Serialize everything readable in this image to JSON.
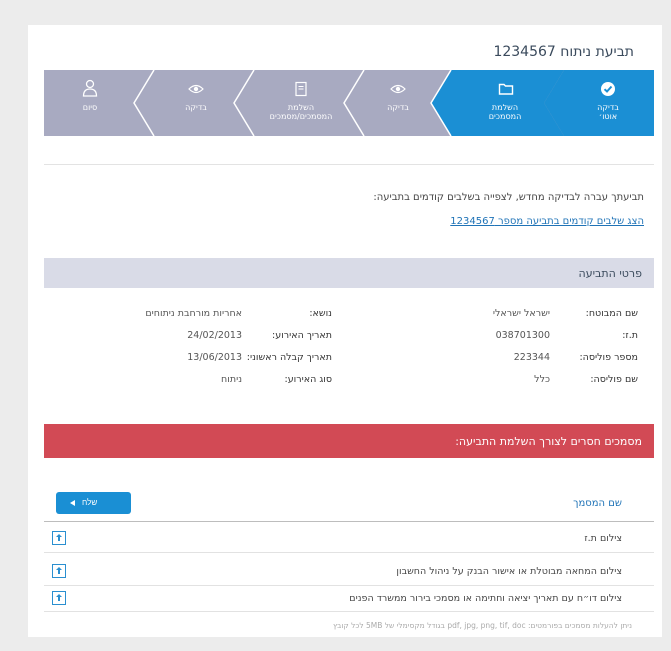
{
  "page": {
    "title": "תביעת ניתוח 1234567"
  },
  "colors": {
    "step_active": "#1b8fd4",
    "step_done": "#1b8fd4",
    "step_inactive": "#a8aac1",
    "accent_red": "#d24a55",
    "section_bg": "#d9dbe7",
    "link": "#1f73b7"
  },
  "stepper": {
    "steps": [
      {
        "label1": "בדיקה",
        "label2": "אוטו׳",
        "icon": "check-circle-icon",
        "state": "done"
      },
      {
        "label1": "השלמת",
        "label2": "המסמכים",
        "icon": "folder-icon",
        "state": "active"
      },
      {
        "label1": "בדיקה",
        "label2": "",
        "icon": "eye-icon",
        "state": "inactive"
      },
      {
        "label1": "השלמת",
        "label2": "המסמכים/מסמכים",
        "icon": "document-icon",
        "state": "inactive"
      },
      {
        "label1": "בדיקה",
        "label2": "",
        "icon": "eye-icon",
        "state": "inactive"
      },
      {
        "label1": "סיום",
        "label2": "",
        "icon": "person-icon",
        "state": "inactive"
      }
    ]
  },
  "notice": {
    "text": "תביעתך עברה לבדיקה מחדש, לצפייה בשלבים קודמים בתביעה:",
    "link": "הצג שלבים קודמים בתביעה מספר 1234567"
  },
  "details": {
    "title": "פרטי התביעה",
    "rows": [
      {
        "l1": "שם המבוטח:",
        "v1": "ישראל ישראלי",
        "l2": "נושא:",
        "v2": "אחריות מורחבת ניתוחים"
      },
      {
        "l1": "ת.ז:",
        "v1": "038701300",
        "l2": "תאריך האירוע:",
        "v2": "24/02/2013"
      },
      {
        "l1": "מספר פוליסה:",
        "v1": "223344",
        "l2": "תאריך קבלה ראשוני:",
        "v2": "13/06/2013"
      },
      {
        "l1": "שם פוליסה:",
        "v1": "כלל",
        "l2": "סוג האירוע:",
        "v2": "ניתוח"
      }
    ]
  },
  "missing_docs": {
    "title": "מסמכים חסרים לצורך השלמת התביעה:",
    "send_button": "שלח",
    "column_header": "שם המסמך",
    "items": [
      "צילום ת.ז",
      "צילום המחאה מבוטלת או אישור הבנק על ניהול החשבון",
      "צילום דו״ח עם תאריך יציאה וחתימה או מסמכי בירור ממשרד הפנים"
    ],
    "footnote": "ניתן להעלות מסמכים בפורמטים: pdf, jpg, png, tif, doc בגודל מקסימלי של 5MB לכל קובץ"
  }
}
